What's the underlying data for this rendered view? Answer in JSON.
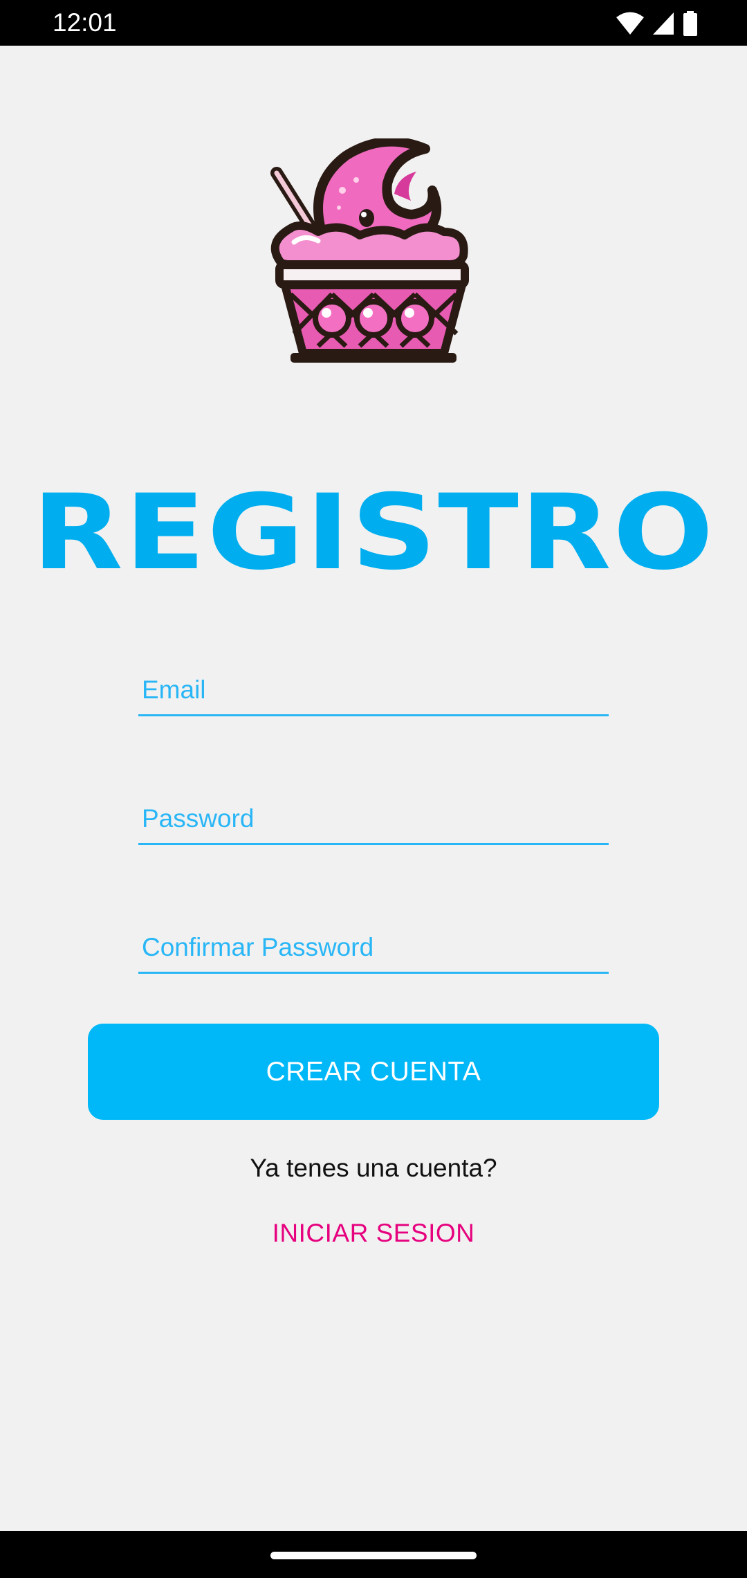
{
  "status_bar": {
    "time": "12:01",
    "icons": [
      "wifi-icon",
      "cellular-signal-icon",
      "battery-icon"
    ]
  },
  "logo": {
    "icon": "ice-cream-cup-logo",
    "colors": {
      "pink": "#f06bbf",
      "dark_pink": "#d63a9a",
      "outline": "#2a1a14"
    }
  },
  "title": "REGISTRO",
  "form": {
    "email_placeholder": "Email",
    "email_value": "",
    "password_placeholder": "Password",
    "password_value": "",
    "confirm_password_placeholder": "Confirmar Password",
    "confirm_password_value": ""
  },
  "create_account_label": "CREAR CUENTA",
  "account_question": "Ya tenes una cuenta?",
  "login_link_label": "INICIAR SESION",
  "colors": {
    "accent": "#00b8f8",
    "title": "#00aef0",
    "link": "#e6007e",
    "background": "#f1f1f1"
  }
}
